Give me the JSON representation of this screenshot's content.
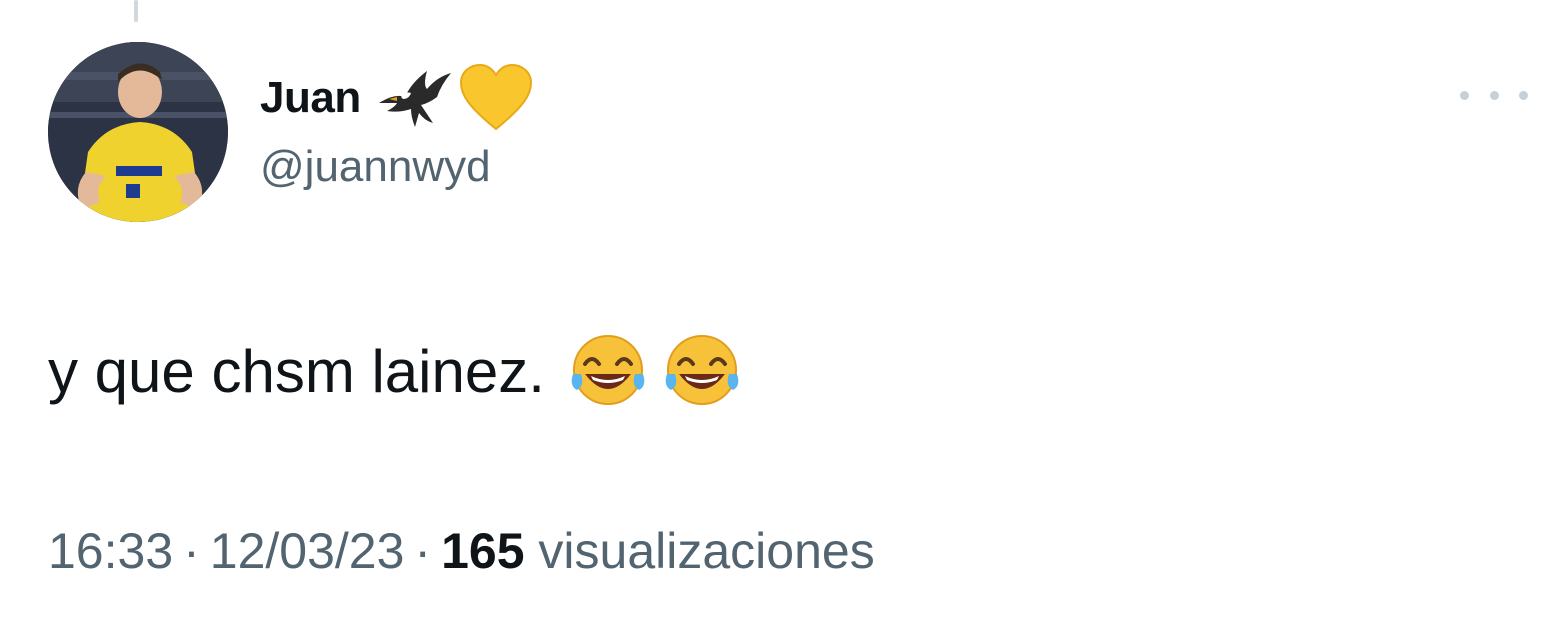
{
  "tweet": {
    "author": {
      "display_name": "Juan",
      "handle": "@juannwyd",
      "badges": [
        "eagle-icon",
        "yellow-heart-icon"
      ]
    },
    "text": "y que chsm lainez.",
    "emojis": [
      "face-with-tears-of-joy-icon",
      "face-with-tears-of-joy-icon"
    ],
    "time": "16:33",
    "date": "12/03/23",
    "views_count": "165",
    "views_label": "visualizaciones",
    "separator": "·"
  },
  "colors": {
    "primary_text": "#0f1419",
    "secondary_text": "#536471",
    "heart": "#f9c62d",
    "jersey": "#f0d22e"
  }
}
